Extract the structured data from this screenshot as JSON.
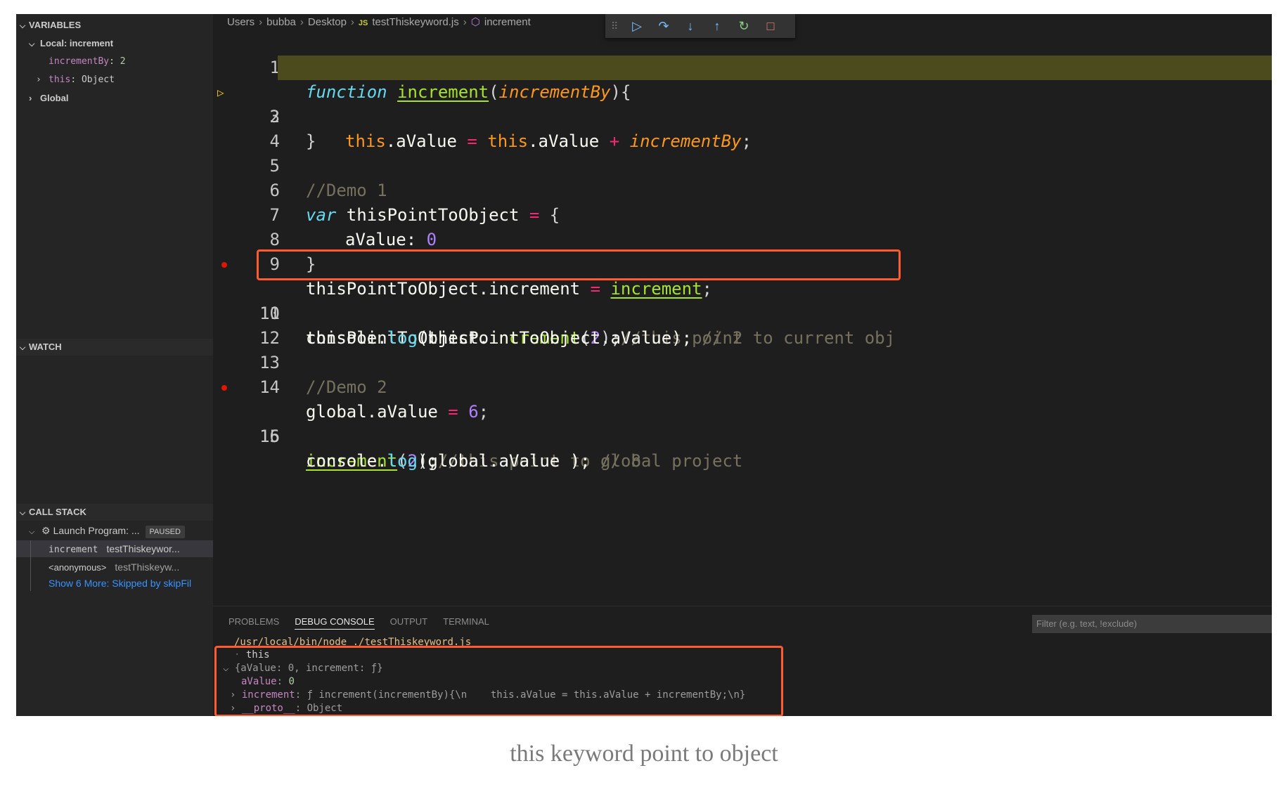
{
  "sidebar": {
    "variables": {
      "title": "VARIABLES",
      "local_label": "Local: increment",
      "items": [
        {
          "name": "incrementBy",
          "value": "2"
        },
        {
          "name": "this",
          "value": "Object"
        }
      ],
      "global_label": "Global"
    },
    "watch": {
      "title": "WATCH"
    },
    "call_stack": {
      "title": "CALL STACK",
      "program": "Launch Program: ...",
      "status": "PAUSED",
      "frames": [
        {
          "fn": "increment",
          "file": "testThiskeywor..."
        },
        {
          "fn": "<anonymous>",
          "file": "testThiskeyw..."
        }
      ],
      "more": "Show 6 More: Skipped by skipFil"
    }
  },
  "breadcrumb": {
    "items": [
      "Users",
      "bubba",
      "Desktop"
    ],
    "file_badge": "JS",
    "file": "testThiskeyword.js",
    "symbol": "increment"
  },
  "debug_toolbar": {
    "icons": [
      "grip-icon",
      "continue-icon",
      "step-over-icon",
      "step-into-icon",
      "step-out-icon",
      "restart-icon",
      "stop-icon"
    ],
    "glyphs": {
      "grip": "⠿",
      "continue": "▷",
      "step_over": "↷",
      "step_into": "↓",
      "step_out": "↑",
      "restart": "↻",
      "stop": "□"
    }
  },
  "editor": {
    "line_numbers": [
      "1",
      "2",
      "3",
      "4",
      "5",
      "6",
      "7",
      "8",
      "9",
      "10",
      "11",
      "12",
      "13",
      "14",
      "15",
      "16"
    ],
    "l1": {
      "kw": "function",
      "name": "increment",
      "p1": "(",
      "param": "incrementBy",
      "p2": "){"
    },
    "l2": {
      "this1": "this",
      "prop1": ".aValue",
      "eq": "=",
      "this2": "this",
      "prop2": ".aValue",
      "plus": "+",
      "param": "incrementBy",
      "semi": ";"
    },
    "l3": {
      "text": "}"
    },
    "l5": {
      "text": "//Demo 1"
    },
    "l6": {
      "kw": "var",
      "name": " thisPointToObject ",
      "eq": "=",
      "rest": " {"
    },
    "l7": {
      "key": "aValue: ",
      "num": "0"
    },
    "l8": {
      "text": "}"
    },
    "l9": {
      "a": "thisPointToObject.increment ",
      "eq": "=",
      "name": "increment",
      "semi": ";"
    },
    "l10": {
      "a": "thisPointToObject.",
      "fn": "increment",
      "b": "(",
      "num": "2",
      "c": ");",
      "cmt": "//this point to current obj"
    },
    "l11": {
      "a": "console.",
      "fn": "log",
      "b": "(thisPointToObject.aValue); ",
      "cmt": "// 2"
    },
    "l13": {
      "text": "//Demo 2"
    },
    "l14": {
      "a": "global.aValue ",
      "eq": "=",
      "num": " 6",
      "semi": ";"
    },
    "l15": {
      "name": "increment",
      "b": "(",
      "num": "2",
      "c": ");",
      "cmt": "//this point to global project"
    },
    "l16": {
      "a": "console.",
      "fn": "log",
      "b": "(global.aValue ); ",
      "cmt": "// 8"
    }
  },
  "panel": {
    "tabs": [
      "PROBLEMS",
      "DEBUG CONSOLE",
      "OUTPUT",
      "TERMINAL"
    ],
    "filter_placeholder": "Filter (e.g. text, !exclude)",
    "console": {
      "cmd_path": "/usr/local/bin/node",
      "cmd_arg": "./testThiskeyword.js",
      "line_this": "this",
      "line_obj": "{aValue: 0, increment: ƒ}",
      "avalue_key": "aValue",
      "avalue_val": "0",
      "increment_key": "increment",
      "increment_val": "ƒ increment(incrementBy){\\n    this.aValue = this.aValue + incrementBy;\\n}",
      "proto_key": "__proto__",
      "proto_val": "Object"
    }
  },
  "caption": "this keyword point to object"
}
